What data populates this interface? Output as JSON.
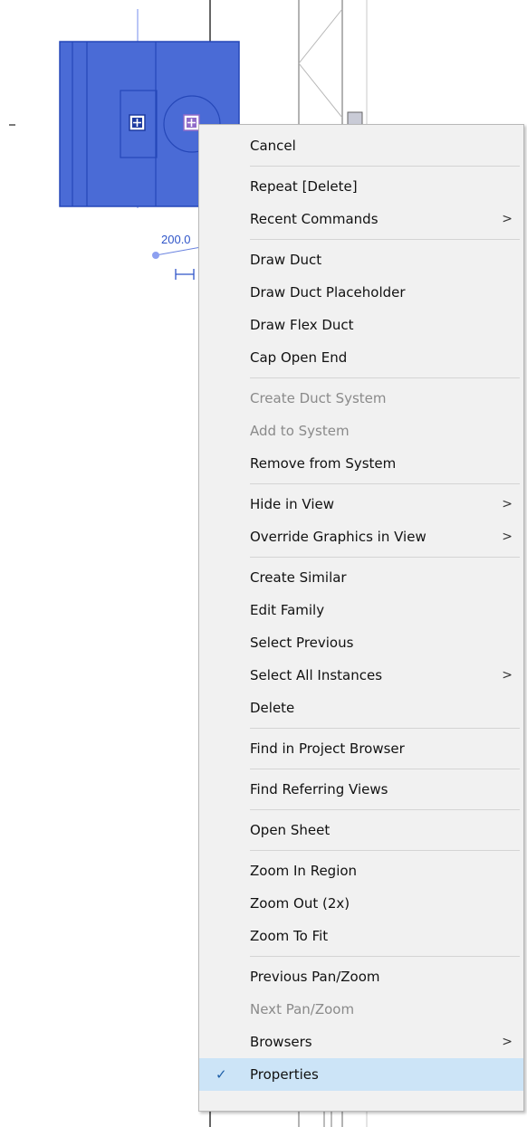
{
  "canvas": {
    "dimension_label": "200.0",
    "colors": {
      "duct_fill": "#4a6bd6",
      "duct_stroke": "#2547b8",
      "grip": "#8f6ac9"
    }
  },
  "menu": {
    "groups": [
      {
        "items": [
          {
            "label": "Cancel"
          }
        ]
      },
      {
        "items": [
          {
            "label": "Repeat [Delete]"
          },
          {
            "label": "Recent Commands",
            "submenu": true
          }
        ]
      },
      {
        "items": [
          {
            "label": "Draw Duct"
          },
          {
            "label": "Draw Duct Placeholder"
          },
          {
            "label": "Draw Flex Duct"
          },
          {
            "label": "Cap Open End"
          }
        ]
      },
      {
        "items": [
          {
            "label": "Create Duct System",
            "disabled": true
          },
          {
            "label": "Add to System",
            "disabled": true
          },
          {
            "label": "Remove from System"
          }
        ]
      },
      {
        "items": [
          {
            "label": "Hide in View",
            "submenu": true
          },
          {
            "label": "Override Graphics in View",
            "submenu": true
          }
        ]
      },
      {
        "items": [
          {
            "label": "Create Similar"
          },
          {
            "label": "Edit Family"
          },
          {
            "label": "Select Previous"
          },
          {
            "label": "Select All Instances",
            "submenu": true
          },
          {
            "label": "Delete"
          }
        ]
      },
      {
        "items": [
          {
            "label": "Find in Project Browser"
          }
        ]
      },
      {
        "items": [
          {
            "label": "Find Referring Views"
          }
        ]
      },
      {
        "items": [
          {
            "label": "Open Sheet"
          }
        ]
      },
      {
        "items": [
          {
            "label": "Zoom In Region"
          },
          {
            "label": "Zoom Out (2x)"
          },
          {
            "label": "Zoom To Fit"
          }
        ]
      },
      {
        "items": [
          {
            "label": "Previous Pan/Zoom"
          },
          {
            "label": "Next Pan/Zoom",
            "disabled": true
          },
          {
            "label": "Browsers",
            "submenu": true
          },
          {
            "label": "Properties",
            "checked": true
          }
        ]
      }
    ],
    "submenu_glyph": ">",
    "check_glyph": "✓"
  }
}
